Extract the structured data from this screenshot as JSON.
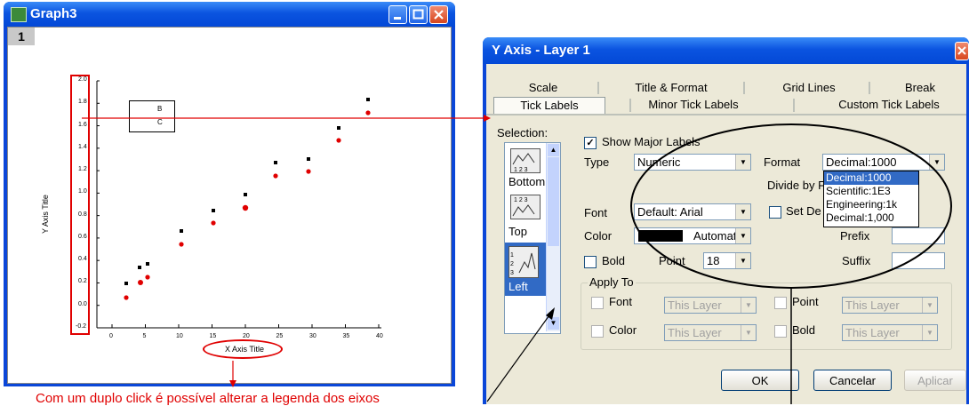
{
  "graph": {
    "title": "Graph3",
    "layer_num": "1",
    "y_ticks": [
      "2.0",
      "1.8",
      "1.6",
      "1.4",
      "1.2",
      "1.0",
      "0.8",
      "0.6",
      "0.4",
      "0.2",
      "0.0",
      "-0.2"
    ],
    "x_ticks": [
      "0",
      "5",
      "10",
      "15",
      "20",
      "25",
      "30",
      "35",
      "40"
    ],
    "y_axis_title": "Y Axis Title",
    "x_axis_title": "X Axis Title",
    "legend_b": "B",
    "legend_c": "C"
  },
  "dialog": {
    "title": "Y Axis - Layer 1",
    "tabs_row1": [
      "Scale",
      "Title & Format",
      "Grid Lines",
      "Break"
    ],
    "tabs_row2": [
      "Tick Labels",
      "Minor Tick Labels",
      "Custom Tick Labels"
    ],
    "selection_label": "Selection:",
    "selection_items": [
      "Bottom",
      "Top",
      "Left"
    ],
    "show_major_labels": "Show Major Labels",
    "type_label": "Type",
    "type_value": "Numeric",
    "format_label": "Format",
    "format_value": "Decimal:1000",
    "format_options": [
      "Decimal:1000",
      "Scientific:1E3",
      "Engineering:1k",
      "Decimal:1,000"
    ],
    "divide_by": "Divide by F",
    "font_label": "Font",
    "font_value": "Default: Arial",
    "set_dec": "Set De",
    "color_label": "Color",
    "color_value": "Automatic",
    "prefix_label": "Prefix",
    "bold_label": "Bold",
    "point_label": "Point",
    "point_value": "18",
    "suffix_label": "Suffix",
    "apply_to": "Apply To",
    "apply_font": "Font",
    "apply_color": "Color",
    "apply_point": "Point",
    "apply_bold": "Bold",
    "this_layer": "This Layer",
    "ok": "OK",
    "cancel": "Cancelar",
    "apply": "Aplicar"
  },
  "annotation": "Com um duplo click é possível alterar a legenda dos eixos",
  "colors": {
    "accent_red": "#e00000",
    "title_blue": "#0b54e0"
  }
}
